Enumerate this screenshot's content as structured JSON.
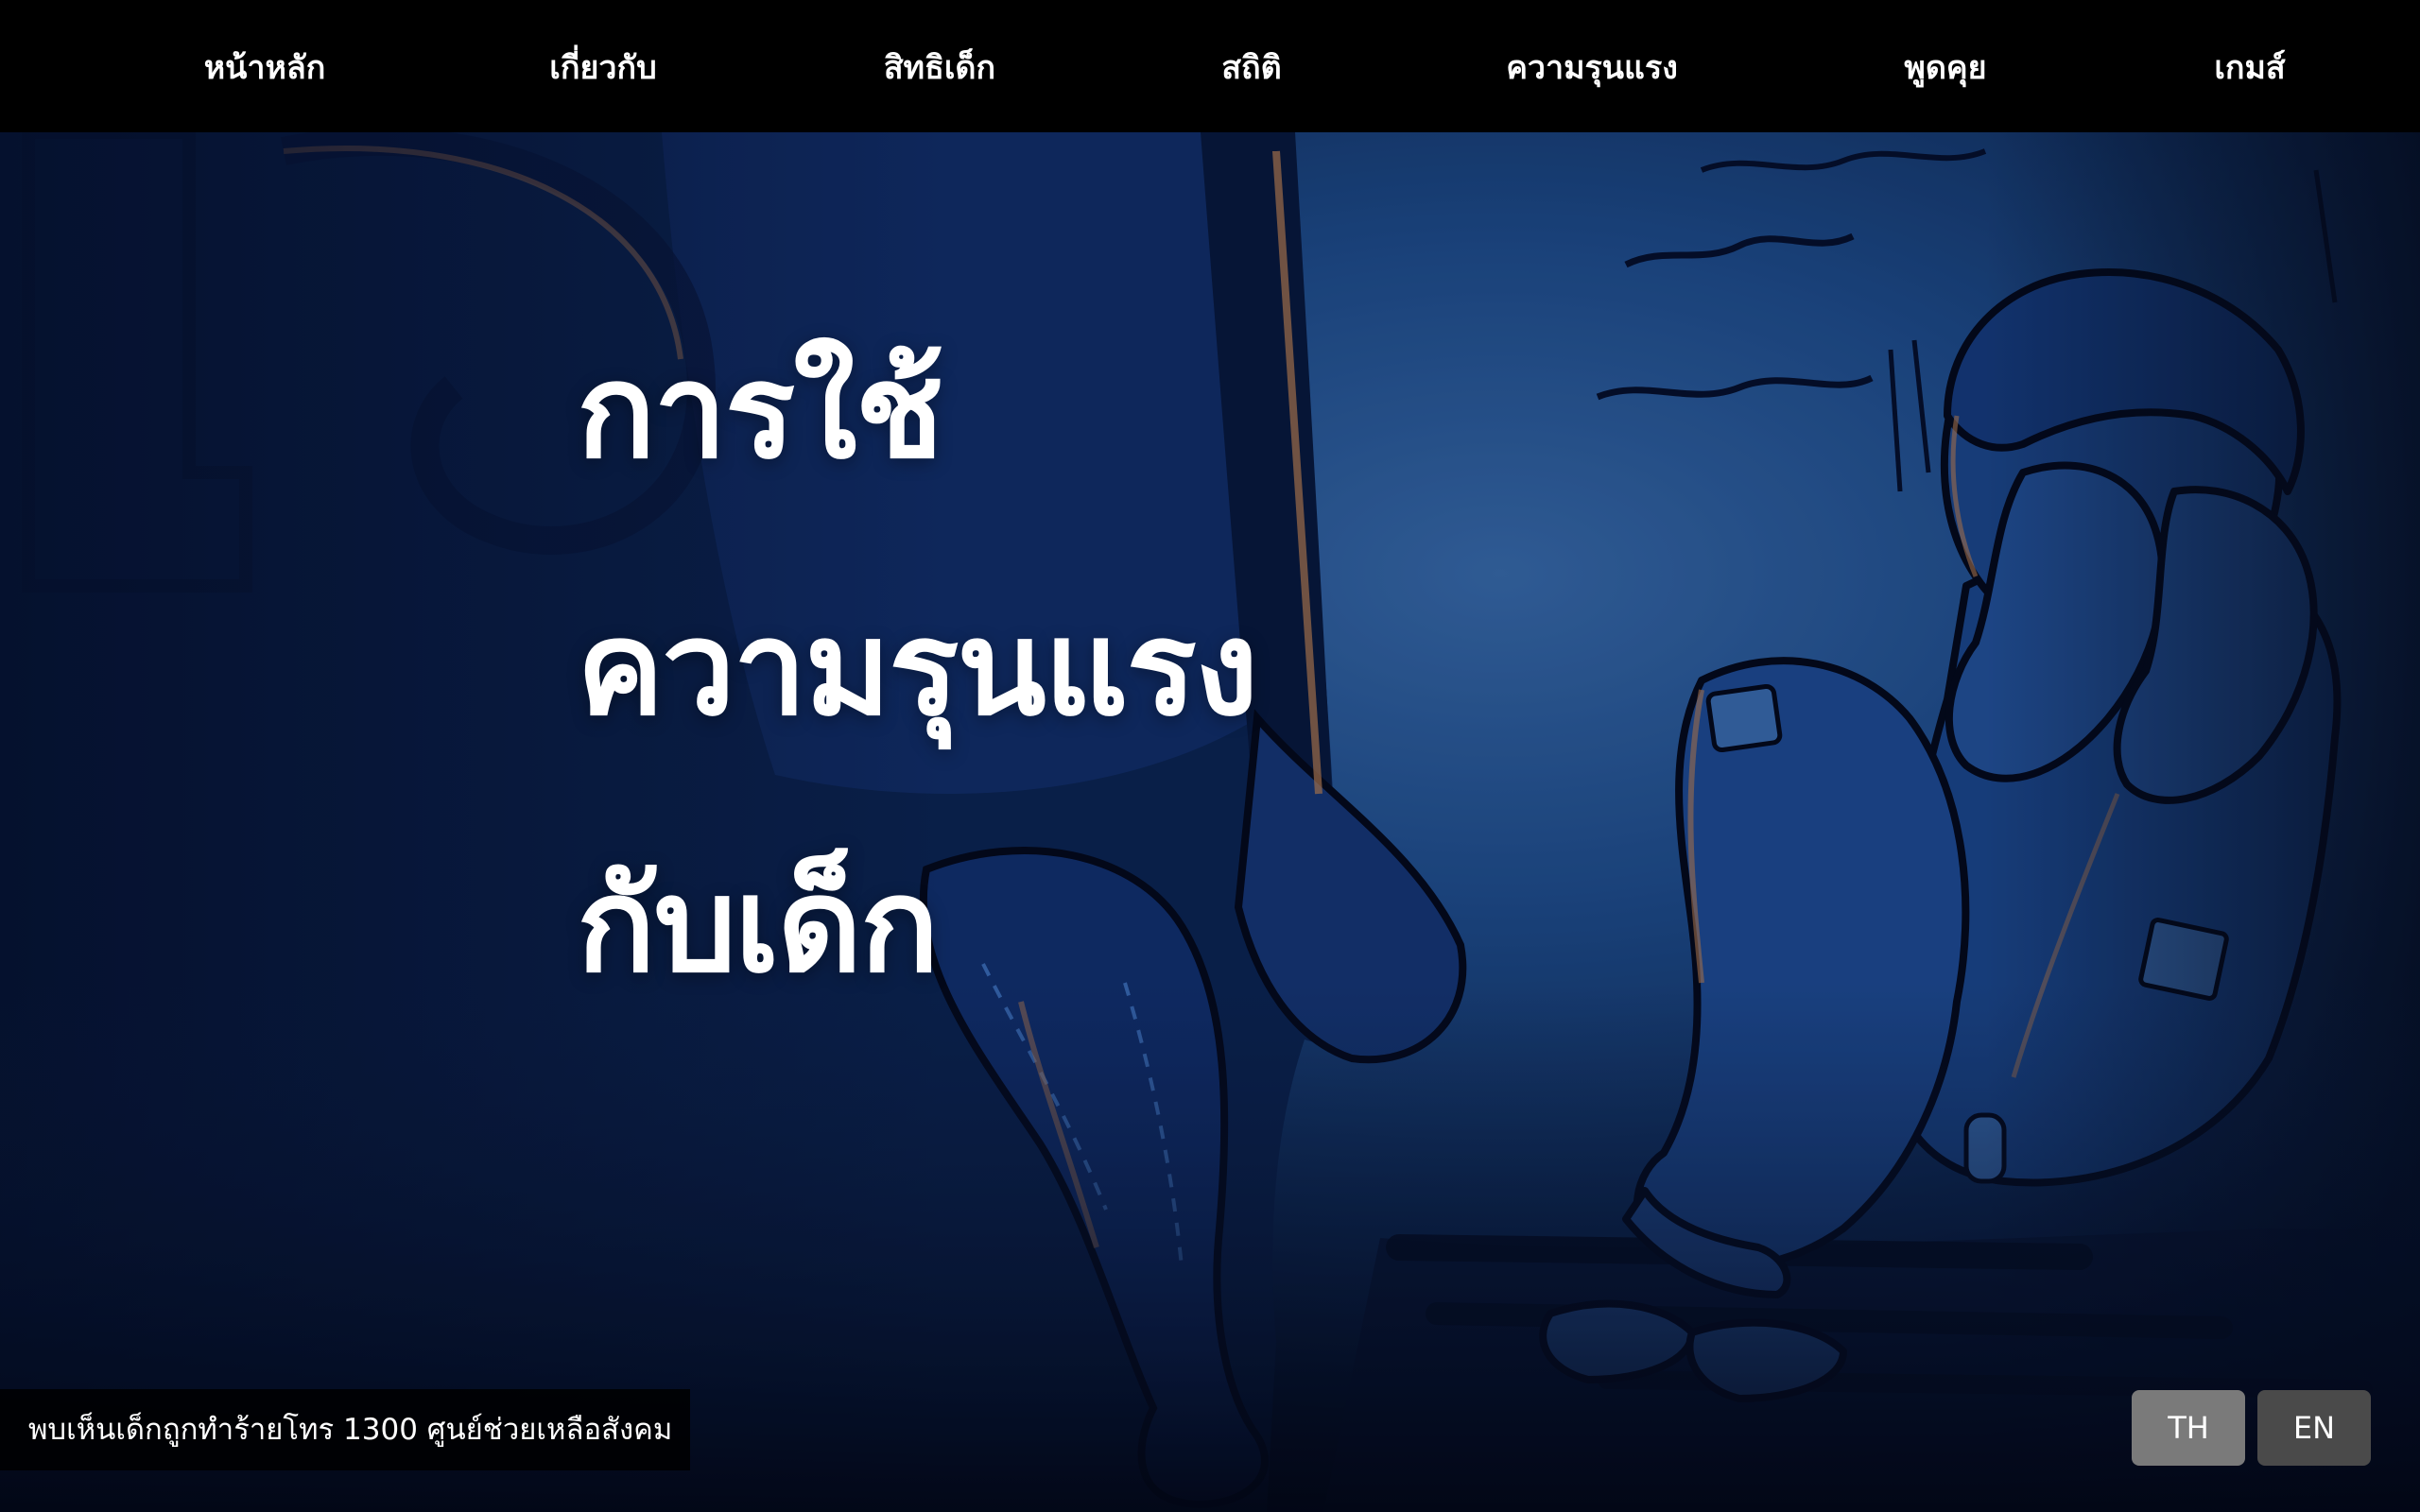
{
  "nav": {
    "items": [
      {
        "label": "หน้าหลัก"
      },
      {
        "label": "เกี่ยวกับ"
      },
      {
        "label": "สิทธิเด็ก"
      },
      {
        "label": "สถิติ"
      },
      {
        "label": "ความรุนแรง"
      },
      {
        "label": "พูดคุย"
      },
      {
        "label": "เกมส์"
      }
    ]
  },
  "hero": {
    "title_lines": [
      "การใช้",
      "ความรุนแรง",
      "กับเด็ก"
    ],
    "illustration": "child-abuse-illustration",
    "colors": {
      "background": "#0a1630",
      "glow": "#2f63a8",
      "nav": "#000000",
      "text": "#ffffff"
    }
  },
  "footer": {
    "hotline": "พบเห็นเด็กถูกทำร้ายโทร 1300 ศูนย์ช่วยเหลือสังคม"
  },
  "language": {
    "th": "TH",
    "en": "EN",
    "active": "TH",
    "active_color": "#7a7a7a",
    "inactive_color": "#4a4a4a"
  }
}
